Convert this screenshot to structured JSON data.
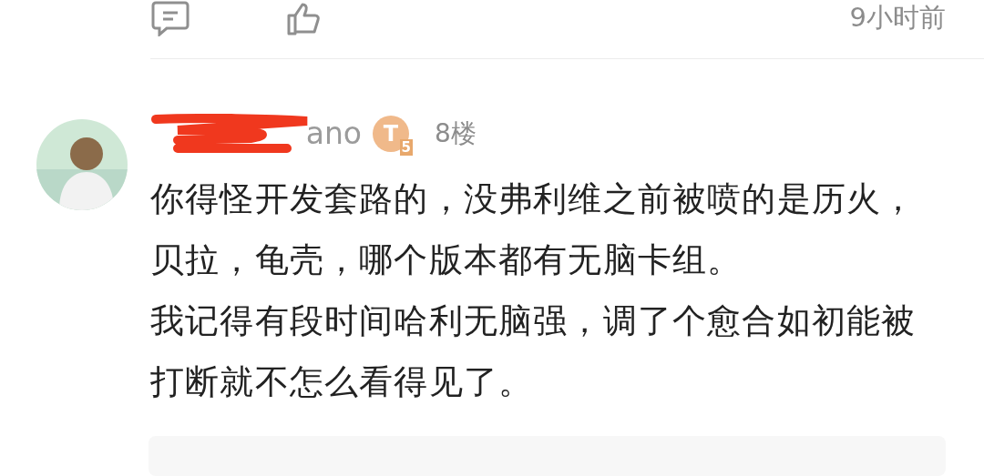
{
  "previous_comment": {
    "time": "9小时前"
  },
  "comment": {
    "username_tail": "ano",
    "username_redacted": true,
    "badge": {
      "letter": "T",
      "level": "5"
    },
    "floor": "8楼",
    "lines": [
      "你得怪开发套路的，没弗利维之前被喷的是历火，",
      "贝拉，龟壳，哪个版本都有无脑卡组。",
      "我记得有段时间哈利无脑强，调了个愈合如初能被",
      "打断就不怎么看得见了。"
    ]
  }
}
